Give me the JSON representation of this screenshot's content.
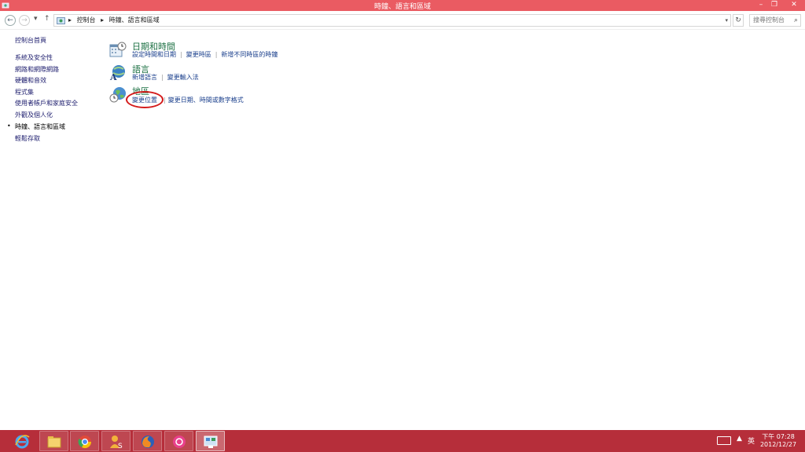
{
  "window": {
    "title": "時鐘、語言和區域",
    "controls": {
      "minimize": "–",
      "restore": "❐",
      "close": "✕"
    }
  },
  "address_bar": {
    "back_icon": "←",
    "forward_icon": "→",
    "recent_icon": "▾",
    "up_icon": "↑",
    "separator": "▸",
    "crumbs": [
      "控制台",
      "時鐘、語言和區域"
    ],
    "dropdown_icon": "▾",
    "refresh_icon": "↻",
    "search_placeholder": "搜尋控制台",
    "search_icon": "⌕"
  },
  "sidebar": {
    "items": [
      {
        "label": "控制台首頁"
      },
      {
        "label": "系統及安全性"
      },
      {
        "label": "網路和網際網路"
      },
      {
        "label": "硬體和音效"
      },
      {
        "label": "程式集"
      },
      {
        "label": "使用者帳戶和家庭安全"
      },
      {
        "label": "外觀及個人化"
      },
      {
        "label": "時鐘、語言和區域",
        "current": true
      },
      {
        "label": "輕鬆存取"
      }
    ]
  },
  "categories": [
    {
      "title": "日期和時間",
      "icon": "date-time-icon",
      "links": [
        "設定時間和日期",
        "變更時區",
        "新增不同時區的時鐘"
      ]
    },
    {
      "title": "語言",
      "icon": "language-icon",
      "links": [
        "新增語言",
        "變更輸入法"
      ]
    },
    {
      "title": "地區",
      "icon": "region-globe-icon",
      "links": [
        "變更位置",
        "變更日期、時間或數字格式"
      ]
    }
  ],
  "taskbar": {
    "apps": [
      "ie-icon",
      "file-explorer-icon",
      "chrome-icon",
      "user-app-icon",
      "firefox-icon",
      "pink-app-icon",
      "control-panel-icon"
    ],
    "ime": "英",
    "tray_arrow": "▲",
    "clock_time": "下午 07:28",
    "clock_date": "2012/12/27"
  },
  "colors": {
    "titlebar": "#ea5b62",
    "taskbar": "#b62e3a",
    "category_title": "#1e7145",
    "link": "#1a3f8c",
    "highlight_ring": "#d41a1a"
  }
}
